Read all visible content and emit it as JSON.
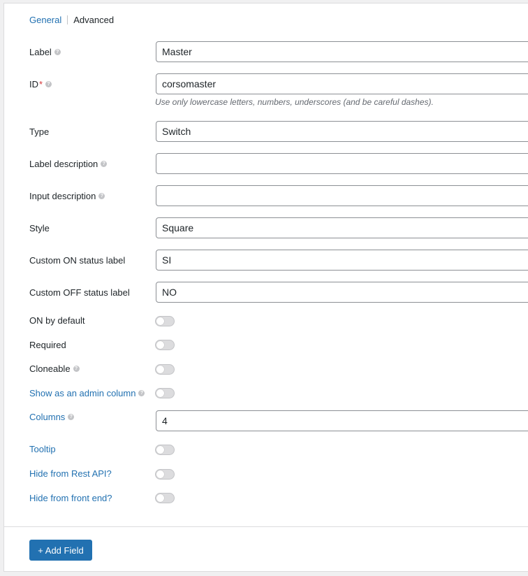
{
  "tabs": {
    "general": "General",
    "advanced": "Advanced"
  },
  "fields": {
    "label": {
      "label": "Label",
      "value": "Master"
    },
    "id": {
      "label": "ID",
      "required_mark": "*",
      "value": "corsomaster",
      "hint": "Use only lowercase letters, numbers, underscores (and be careful dashes)."
    },
    "type": {
      "label": "Type",
      "value": "Switch"
    },
    "label_description": {
      "label": "Label description",
      "value": ""
    },
    "input_description": {
      "label": "Input description",
      "value": ""
    },
    "style": {
      "label": "Style",
      "value": "Square"
    },
    "on_label": {
      "label": "Custom ON status label",
      "value": "SI"
    },
    "off_label": {
      "label": "Custom OFF status label",
      "value": "NO"
    },
    "on_by_default": {
      "label": "ON by default",
      "checked": false
    },
    "required": {
      "label": "Required",
      "checked": false
    },
    "cloneable": {
      "label": "Cloneable",
      "checked": false
    },
    "admin_column": {
      "label": "Show as an admin column",
      "checked": false
    },
    "columns": {
      "label": "Columns",
      "value": "4"
    },
    "tooltip": {
      "label": "Tooltip",
      "checked": false
    },
    "hide_rest": {
      "label": "Hide from Rest API?",
      "checked": false
    },
    "hide_front": {
      "label": "Hide from front end?",
      "checked": false
    }
  },
  "help_icon": "question-circle-icon",
  "add_field_button": "+ Add Field",
  "colors": {
    "link": "#2271b1",
    "primary_button": "#2271b1",
    "required": "#d63638"
  }
}
